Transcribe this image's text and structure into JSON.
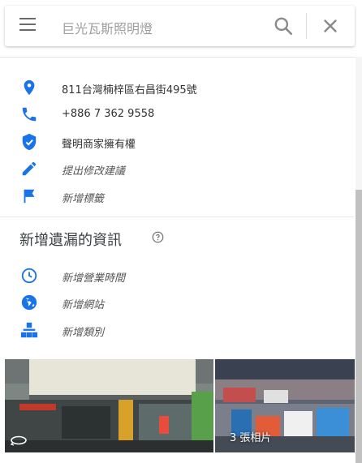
{
  "search": {
    "query": "巨光瓦斯照明燈"
  },
  "place_info": [
    {
      "icon": "location-pin-icon",
      "text": "811台灣楠梓區右昌街495號"
    },
    {
      "icon": "phone-icon",
      "text": "+886 7 362 9558"
    },
    {
      "icon": "verified-shield-icon",
      "text": "聲明商家擁有權"
    },
    {
      "icon": "edit-pencil-icon",
      "text": "提出修改建議"
    },
    {
      "icon": "flag-icon",
      "text": "新增標籤"
    }
  ],
  "missing_info": {
    "title": "新增遺漏的資訊",
    "items": [
      {
        "icon": "clock-icon",
        "text": "新增營業時間"
      },
      {
        "icon": "globe-icon",
        "text": "新增網站"
      },
      {
        "icon": "category-icon",
        "text": "新增類別"
      }
    ]
  },
  "photos": {
    "count_label": "3 張相片"
  },
  "colors": {
    "accent_blue": "#1a73e8",
    "icon_grey": "#757575"
  }
}
